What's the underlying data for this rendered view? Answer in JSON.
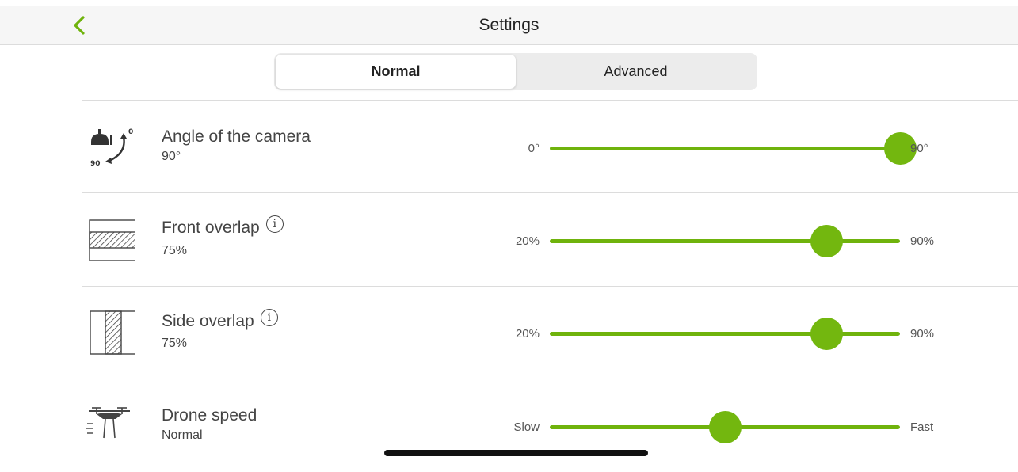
{
  "header": {
    "title": "Settings",
    "back_icon": "chevron-left-icon"
  },
  "tabs": [
    {
      "label": "Normal",
      "active": true
    },
    {
      "label": "Advanced",
      "active": false
    }
  ],
  "accent_color": "#73b70f",
  "settings": [
    {
      "icon": "camera-angle-icon",
      "title": "Angle of the camera",
      "value": "90°",
      "has_info": false,
      "min_label": "0°",
      "max_label": "90°",
      "position_fraction": 1.0
    },
    {
      "icon": "front-overlap-icon",
      "title": "Front overlap",
      "value": "75%",
      "has_info": true,
      "min_label": "20%",
      "max_label": "90%",
      "position_fraction": 0.79
    },
    {
      "icon": "side-overlap-icon",
      "title": "Side overlap",
      "value": "75%",
      "has_info": true,
      "min_label": "20%",
      "max_label": "90%",
      "position_fraction": 0.79
    },
    {
      "icon": "drone-icon",
      "title": "Drone speed",
      "value": "Normal",
      "has_info": false,
      "min_label": "Slow",
      "max_label": "Fast",
      "position_fraction": 0.5
    }
  ]
}
